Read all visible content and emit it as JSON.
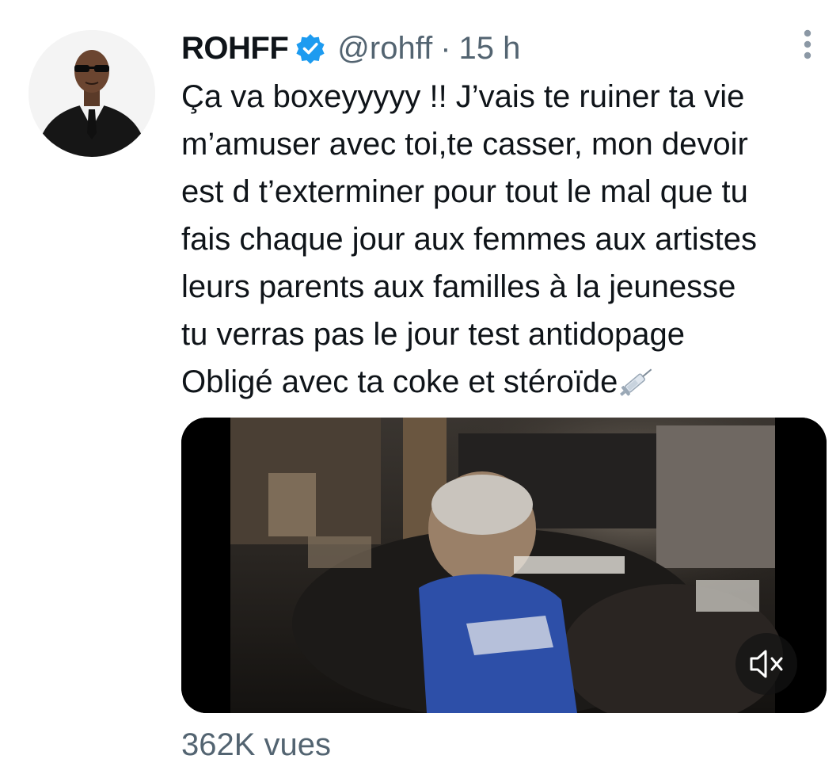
{
  "tweet": {
    "author": {
      "display_name": "ROHFF",
      "handle": "@rohff",
      "verified": true
    },
    "separator": "·",
    "timestamp": "15 h",
    "text_lines": [
      "Ça va boxeyyyyy !! J’vais te ruiner ta vie",
      "m’amuser avec toi,te casser, mon devoir",
      "est d t’exterminer pour tout le mal que tu",
      "fais chaque jour aux femmes aux artistes",
      "leurs parents aux familles à la jeunesse",
      "tu verras pas le jour test antidopage",
      "Obligé avec ta coke et stéroïde"
    ],
    "text_emoji": "syringe-icon",
    "media": {
      "type": "video",
      "muted": true
    },
    "views": "362K vues"
  },
  "colors": {
    "text_primary": "#0f1419",
    "text_secondary": "#536471",
    "verified_blue": "#1d9bf0",
    "background": "#ffffff"
  },
  "icons": {
    "more": "more-vertical-icon",
    "verified": "verified-badge-icon",
    "mute": "volume-muted-icon"
  }
}
